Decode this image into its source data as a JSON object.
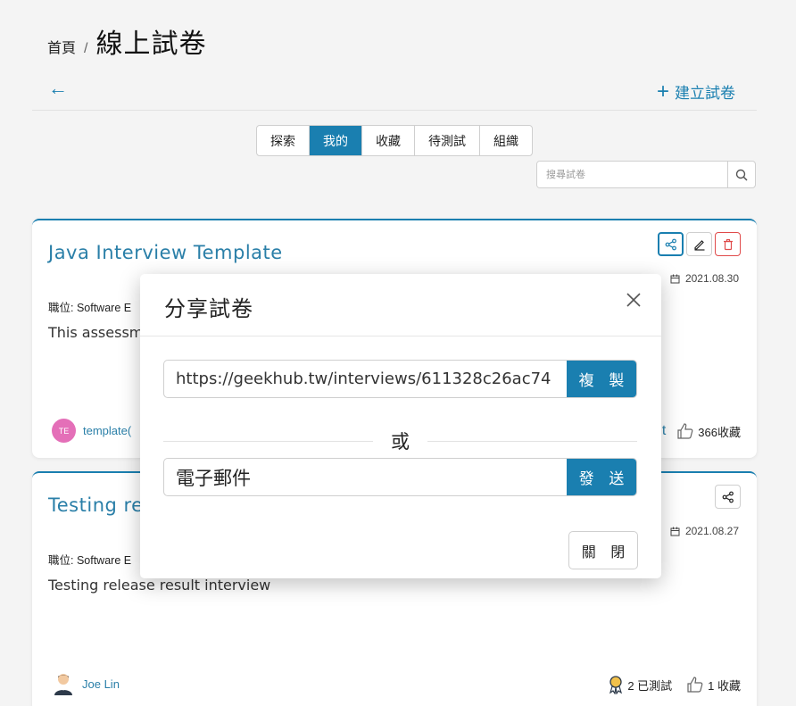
{
  "breadcrumb": {
    "home": "首頁",
    "separator": "/",
    "title": "線上試卷"
  },
  "header": {
    "back_icon": "arrow-left-icon",
    "back_glyph": "←",
    "create_plus": "+",
    "create_label": "建立試卷"
  },
  "tabs": [
    {
      "label": "探索",
      "active": false
    },
    {
      "label": "我的",
      "active": true
    },
    {
      "label": "收藏",
      "active": false
    },
    {
      "label": "待測試",
      "active": false
    },
    {
      "label": "組織",
      "active": false
    }
  ],
  "search": {
    "placeholder": "搜尋試卷"
  },
  "cards": [
    {
      "title": "Java Interview Template",
      "job": "職位: Software E",
      "desc": "This assessm",
      "date": "2021.08.30",
      "author_initials": "TE",
      "author": "template(",
      "stat_partial": "t",
      "likes": "366收藏"
    },
    {
      "title": "Testing re",
      "job": "職位: Software E",
      "desc": "Testing release result interview",
      "date": "2021.08.27",
      "author": "Joe Lin",
      "tested": "2 已測試",
      "likes": "1 收藏"
    }
  ],
  "modal": {
    "title": "分享試卷",
    "link": "https://geekhub.tw/interviews/611328c26ac74",
    "copy_label": "複 製",
    "or_label": "或",
    "email_value": "電子郵件",
    "send_label": "發 送",
    "close_label": "關 閉"
  },
  "colors": {
    "accent": "#1a7fb0",
    "danger": "#e04a4a",
    "avatar_bg": "#e46fb8"
  }
}
